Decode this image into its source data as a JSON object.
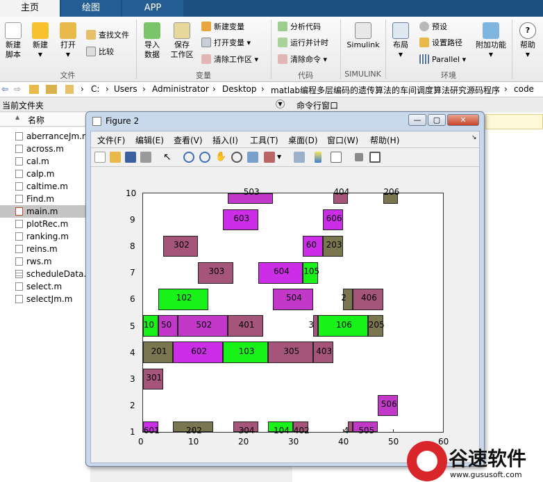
{
  "tabs": [
    {
      "label": "主页",
      "active": true
    },
    {
      "label": "绘图",
      "active": false
    },
    {
      "label": "APP",
      "active": false
    }
  ],
  "ribbon": {
    "file_group": "文件",
    "variable_group": "变量",
    "code_group": "代码",
    "simulink_group": "SIMULINK",
    "env_group": "环境",
    "new_script": "新建\n脚本",
    "new": "新建",
    "open": "打开",
    "find_files": "查找文件",
    "compare": "比较",
    "import_data": "导入\n数据",
    "save_workspace": "保存\n工作区",
    "new_variable": "新建变量",
    "open_variable": "打开变量",
    "clear_workspace": "清除工作区",
    "analyze_code": "分析代码",
    "run_and_time": "运行并计时",
    "clear_commands": "清除命令",
    "simulink": "Simulink",
    "layout": "布局",
    "preferences": "预设",
    "set_path": "设置路径",
    "parallel": "Parallel",
    "addons": "附加功能",
    "help": "帮助"
  },
  "address": {
    "crumbs": [
      "C:",
      "Users",
      "Administrator",
      "Desktop",
      "matlab编程多层编码的遗传算法的车间调度算法研究源码程序",
      "code"
    ],
    "sep": "›"
  },
  "left_panel": {
    "title": "当前文件夹",
    "column": "名称",
    "sort_arrow": "▲",
    "files": [
      {
        "name": "aberranceJm.m",
        "selected": false
      },
      {
        "name": "across.m",
        "selected": false
      },
      {
        "name": "cal.m",
        "selected": false
      },
      {
        "name": "calp.m",
        "selected": false
      },
      {
        "name": "caltime.m",
        "selected": false
      },
      {
        "name": "Find.m",
        "selected": false
      },
      {
        "name": "main.m",
        "selected": true
      },
      {
        "name": "plotRec.m",
        "selected": false
      },
      {
        "name": "ranking.m",
        "selected": false
      },
      {
        "name": "reins.m",
        "selected": false
      },
      {
        "name": "rws.m",
        "selected": false
      },
      {
        "name": "scheduleData.m",
        "selected": false
      },
      {
        "name": "select.m",
        "selected": false
      },
      {
        "name": "selectJm.m",
        "selected": false
      }
    ]
  },
  "right_panel": {
    "title": "命令行窗口"
  },
  "figure": {
    "title": "Figure 2",
    "menus": [
      "文件(F)",
      "编辑(E)",
      "查看(V)",
      "插入(I)",
      "工具(T)",
      "桌面(D)",
      "窗口(W)",
      "帮助(H)"
    ],
    "min": "—",
    "max": "▢",
    "close": "✕"
  },
  "colors": {
    "magenta": "#cc2ee8",
    "green": "#19f219",
    "mauve": "#a6557a",
    "olive": "#7a7650",
    "purple": "#c238c9",
    "title_bar": "#1b4f80"
  },
  "chart_data": {
    "type": "gantt",
    "xlim": [
      0,
      60
    ],
    "ylim": [
      1,
      10
    ],
    "xticks": [
      0,
      10,
      20,
      30,
      40,
      50,
      60
    ],
    "yticks": [
      1,
      2,
      3,
      4,
      5,
      6,
      7,
      8,
      9,
      10
    ],
    "bars": [
      {
        "label": "601",
        "start": 0,
        "end": 3,
        "machine": 1,
        "color": "magenta"
      },
      {
        "label": "202",
        "start": 6,
        "end": 14,
        "machine": 1,
        "color": "olive"
      },
      {
        "label": "304",
        "start": 18,
        "end": 23,
        "machine": 1,
        "color": "mauve"
      },
      {
        "label": "104",
        "start": 25,
        "end": 30,
        "machine": 1,
        "color": "green"
      },
      {
        "label": "402",
        "start": 30,
        "end": 33,
        "machine": 1,
        "color": "mauve"
      },
      {
        "label": "4",
        "start": 41,
        "end": 42,
        "machine": 1,
        "color": "mauve"
      },
      {
        "label": "505",
        "start": 42,
        "end": 47,
        "machine": 1,
        "color": "purple"
      },
      {
        "label": "506",
        "start": 47,
        "end": 51,
        "machine": 2,
        "color": "purple"
      },
      {
        "label": "301",
        "start": 0,
        "end": 4,
        "machine": 3,
        "color": "mauve"
      },
      {
        "label": "201",
        "start": 0,
        "end": 6,
        "machine": 4,
        "color": "olive"
      },
      {
        "label": "602",
        "start": 6,
        "end": 16,
        "machine": 4,
        "color": "magenta"
      },
      {
        "label": "103",
        "start": 16,
        "end": 25,
        "machine": 4,
        "color": "green"
      },
      {
        "label": "305",
        "start": 25,
        "end": 34,
        "machine": 4,
        "color": "mauve"
      },
      {
        "label": "403",
        "start": 34,
        "end": 38,
        "machine": 4,
        "color": "mauve"
      },
      {
        "label": "10",
        "start": 0,
        "end": 3,
        "machine": 5,
        "color": "green"
      },
      {
        "label": "50",
        "start": 3,
        "end": 7,
        "machine": 5,
        "color": "purple"
      },
      {
        "label": "502",
        "start": 7,
        "end": 17,
        "machine": 5,
        "color": "purple"
      },
      {
        "label": "401",
        "start": 17,
        "end": 24,
        "machine": 5,
        "color": "mauve"
      },
      {
        "label": "3",
        "start": 34,
        "end": 35,
        "machine": 5,
        "color": "mauve"
      },
      {
        "label": "106",
        "start": 35,
        "end": 45,
        "machine": 5,
        "color": "green"
      },
      {
        "label": "205",
        "start": 45,
        "end": 48,
        "machine": 5,
        "color": "olive"
      },
      {
        "label": "102",
        "start": 3,
        "end": 13,
        "machine": 6,
        "color": "green"
      },
      {
        "label": "504",
        "start": 26,
        "end": 34,
        "machine": 6,
        "color": "purple"
      },
      {
        "label": "2",
        "start": 40,
        "end": 42,
        "machine": 6,
        "color": "olive"
      },
      {
        "label": "406",
        "start": 42,
        "end": 48,
        "machine": 6,
        "color": "mauve"
      },
      {
        "label": "303",
        "start": 11,
        "end": 18,
        "machine": 7,
        "color": "mauve"
      },
      {
        "label": "604",
        "start": 23,
        "end": 32,
        "machine": 7,
        "color": "magenta"
      },
      {
        "label": "105",
        "start": 32,
        "end": 35,
        "machine": 7,
        "color": "green"
      },
      {
        "label": "302",
        "start": 4,
        "end": 11,
        "machine": 8,
        "color": "mauve"
      },
      {
        "label": "60",
        "start": 32,
        "end": 36,
        "machine": 8,
        "color": "magenta"
      },
      {
        "label": "203",
        "start": 36,
        "end": 40,
        "machine": 8,
        "color": "olive"
      },
      {
        "label": "603",
        "start": 16,
        "end": 23,
        "machine": 9,
        "color": "magenta"
      },
      {
        "label": "606",
        "start": 36,
        "end": 40,
        "machine": 9,
        "color": "magenta"
      },
      {
        "label": "503",
        "start": 17,
        "end": 26,
        "machine": 10,
        "color": "purple"
      },
      {
        "label": "404",
        "start": 38,
        "end": 41,
        "machine": 10,
        "color": "mauve"
      },
      {
        "label": "206",
        "start": 48,
        "end": 51,
        "machine": 10,
        "color": "olive"
      }
    ]
  },
  "watermark": {
    "text": "谷速软件",
    "url": "www.gususoft.com"
  }
}
